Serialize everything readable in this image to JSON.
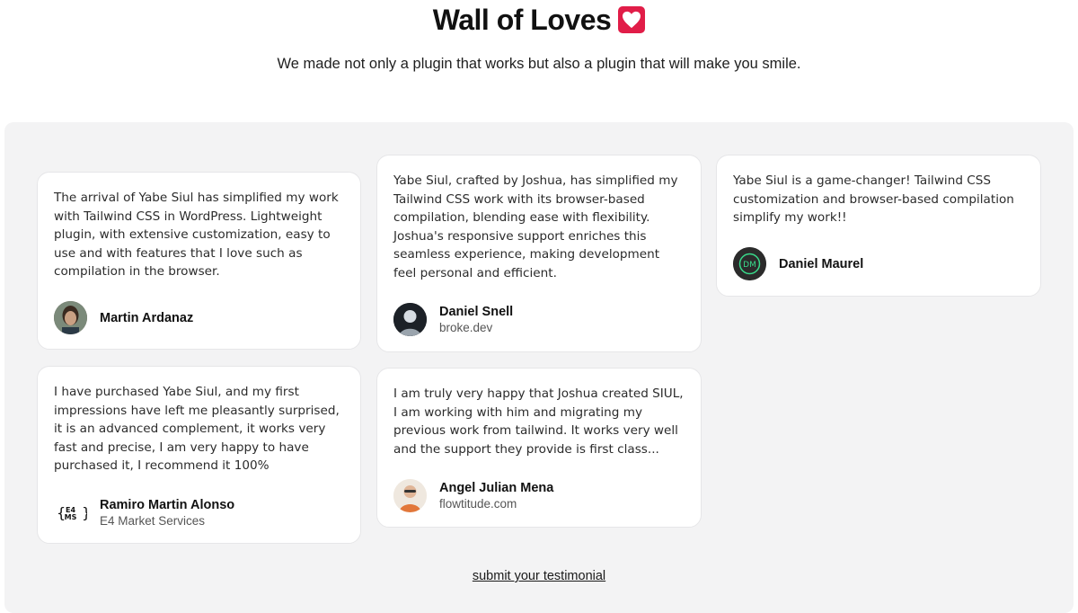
{
  "header": {
    "title": "Wall of Loves",
    "subtitle": "We made not only a plugin that works but also a plugin that will make you smile."
  },
  "testimonials": [
    {
      "quote": "The arrival of Yabe Siul has simplified my work with Tailwind CSS in WordPress. Lightweight plugin, with extensive customization, easy to use and with features that I love such as compilation in the browser.",
      "name": "Martin Ardanaz",
      "subtitle": ""
    },
    {
      "quote": "Yabe Siul, crafted by Joshua, has simplified my Tailwind CSS work with its browser-based compilation, blending ease with flexibility. Joshua's responsive support enriches this seamless experience, making development feel personal and efficient.",
      "name": "Daniel Snell",
      "subtitle": "broke.dev"
    },
    {
      "quote": "Yabe Siul is a game-changer! Tailwind CSS customization and browser-based compilation simplify my work!!",
      "name": "Daniel Maurel",
      "subtitle": "",
      "avatar_initials": "DM"
    },
    {
      "quote": "I have purchased Yabe Siul, and my first impressions have left me pleasantly surprised, it is an advanced complement, it works very fast and precise, I am very happy to have purchased it, I recommend it 100%",
      "name": "Ramiro Martin Alonso",
      "subtitle": "E4 Market Services",
      "avatar_logo_top": "E4",
      "avatar_logo_bottom": "MS"
    },
    {
      "quote": "I am truly very happy that Joshua created SIUL, I am working with him and migrating my previous work from tailwind. It works very well and the support they provide is first class...",
      "name": "Angel Julian Mena",
      "subtitle": "flowtitude.com"
    }
  ],
  "footer": {
    "submit_label": "submit your testimonial"
  },
  "colors": {
    "heart_bg": "#e11d48",
    "wall_bg": "#f3f3f4",
    "card_border": "#e6e6e8"
  },
  "icons": {
    "title_icon": "heart-icon"
  }
}
